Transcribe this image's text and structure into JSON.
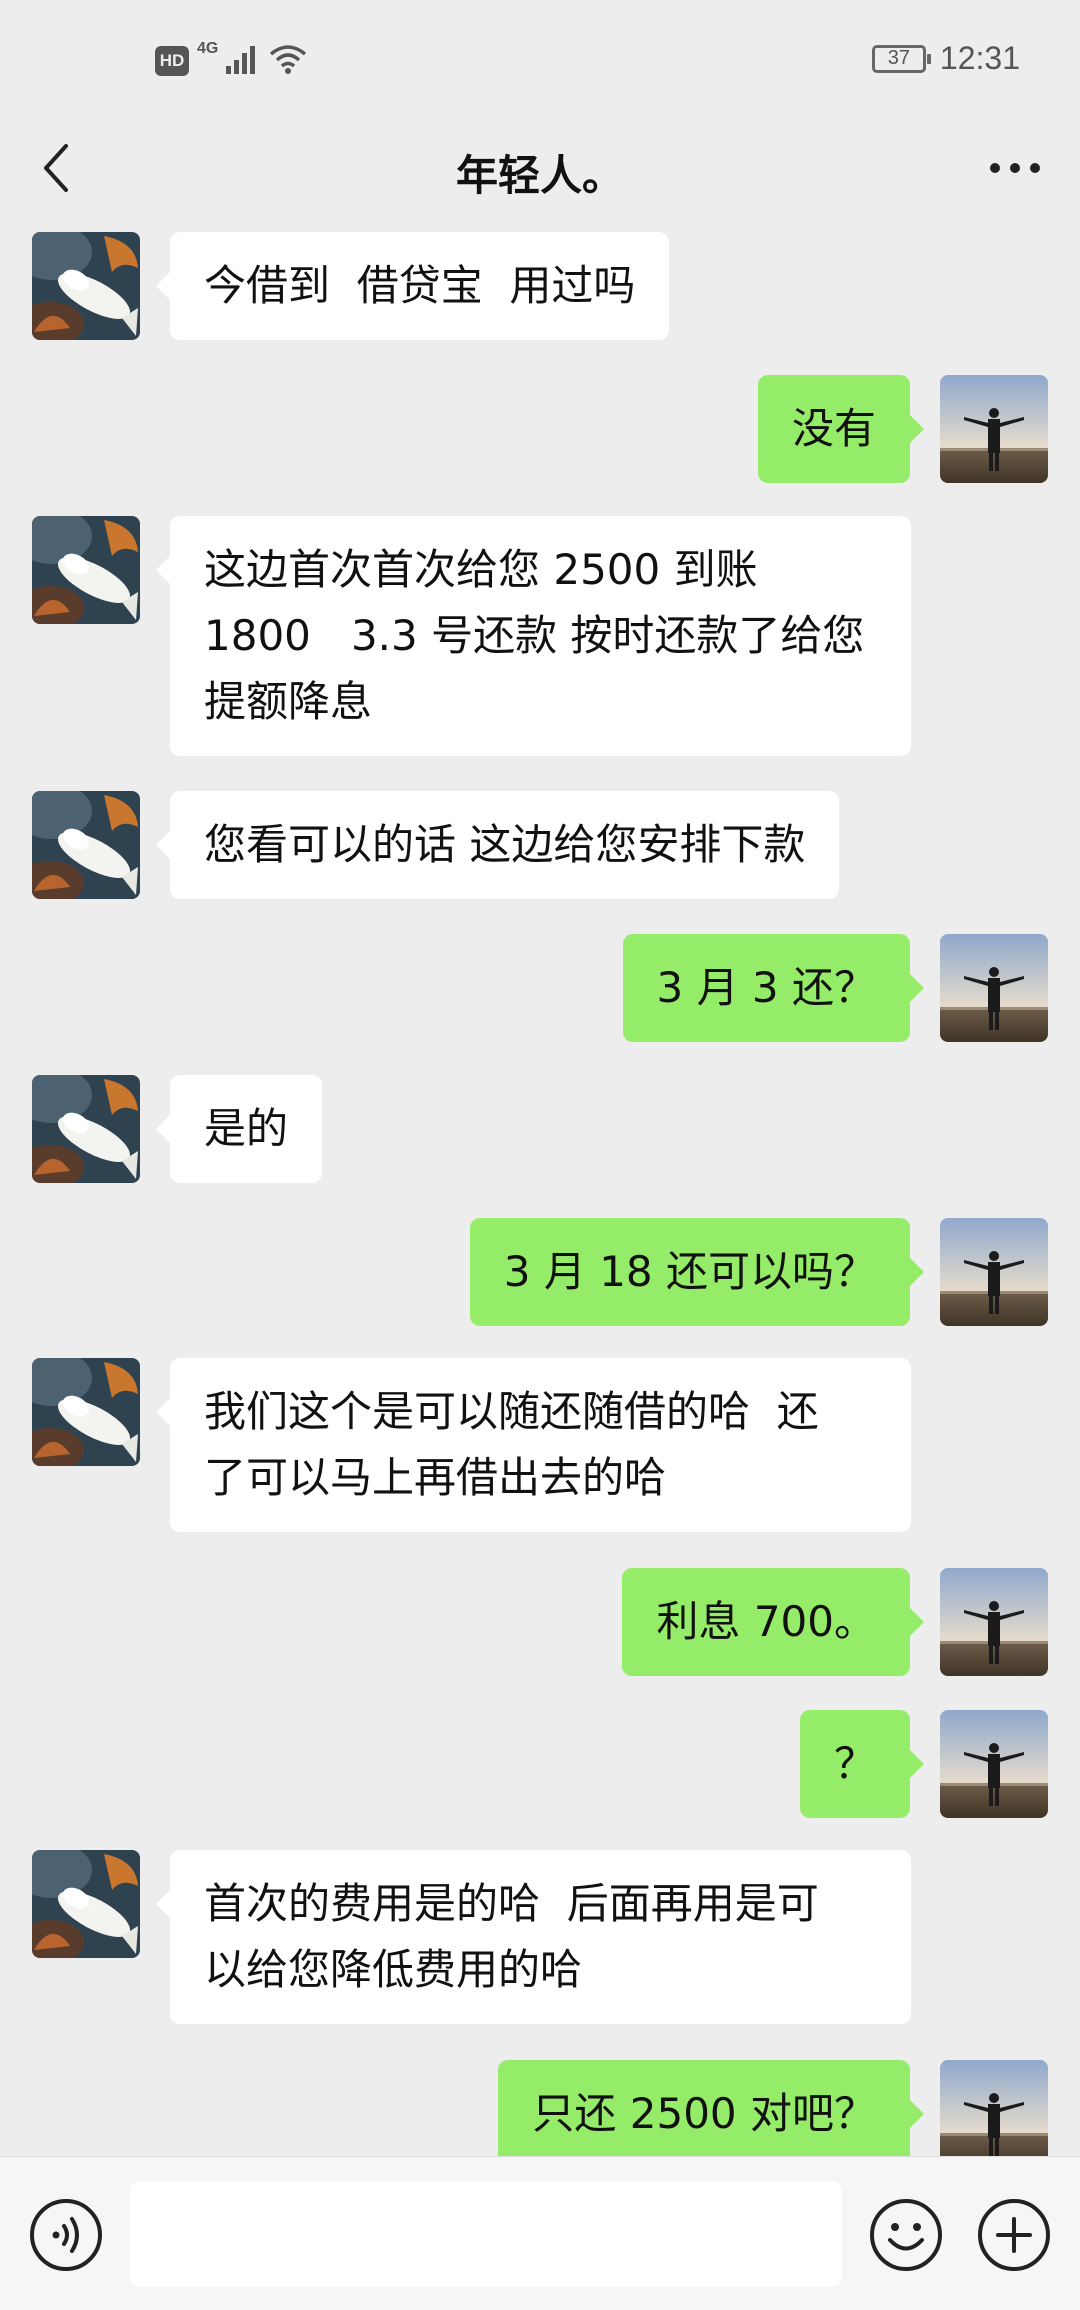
{
  "status_bar": {
    "hd": "HD",
    "network": "4G",
    "battery": "37",
    "time": "12:31"
  },
  "header": {
    "title": "年轻人。",
    "back_icon": "chevron-left-icon",
    "more_icon": "more-horizontal-icon"
  },
  "messages": [
    {
      "side": "left",
      "text": "今借到  借贷宝  用过吗"
    },
    {
      "side": "right",
      "text": "没有"
    },
    {
      "side": "left",
      "text": "这边首次首次给您 2500 到账\n1800   3.3 号还款 按时还款了给您\n提额降息"
    },
    {
      "side": "left",
      "text": "您看可以的话 这边给您安排下款"
    },
    {
      "side": "right",
      "text": "3 月 3 还？"
    },
    {
      "side": "left",
      "text": "是的"
    },
    {
      "side": "right",
      "text": "3 月 18 还可以吗？"
    },
    {
      "side": "left",
      "text": "我们这个是可以随还随借的哈  还\n了可以马上再借出去的哈"
    },
    {
      "side": "right",
      "text": "利息 700。"
    },
    {
      "side": "right",
      "text": "？"
    },
    {
      "side": "left",
      "text": "首次的费用是的哈  后面再用是可\n以给您降低费用的哈"
    },
    {
      "side": "right",
      "text": "只还 2500 对吧？"
    }
  ],
  "input_bar": {
    "voice_icon": "voice-icon",
    "input_value": "",
    "emoji_icon": "emoji-icon",
    "plus_icon": "plus-icon"
  },
  "colors": {
    "background": "#ededed",
    "incoming_bubble": "#ffffff",
    "outgoing_bubble": "#95ec69"
  }
}
